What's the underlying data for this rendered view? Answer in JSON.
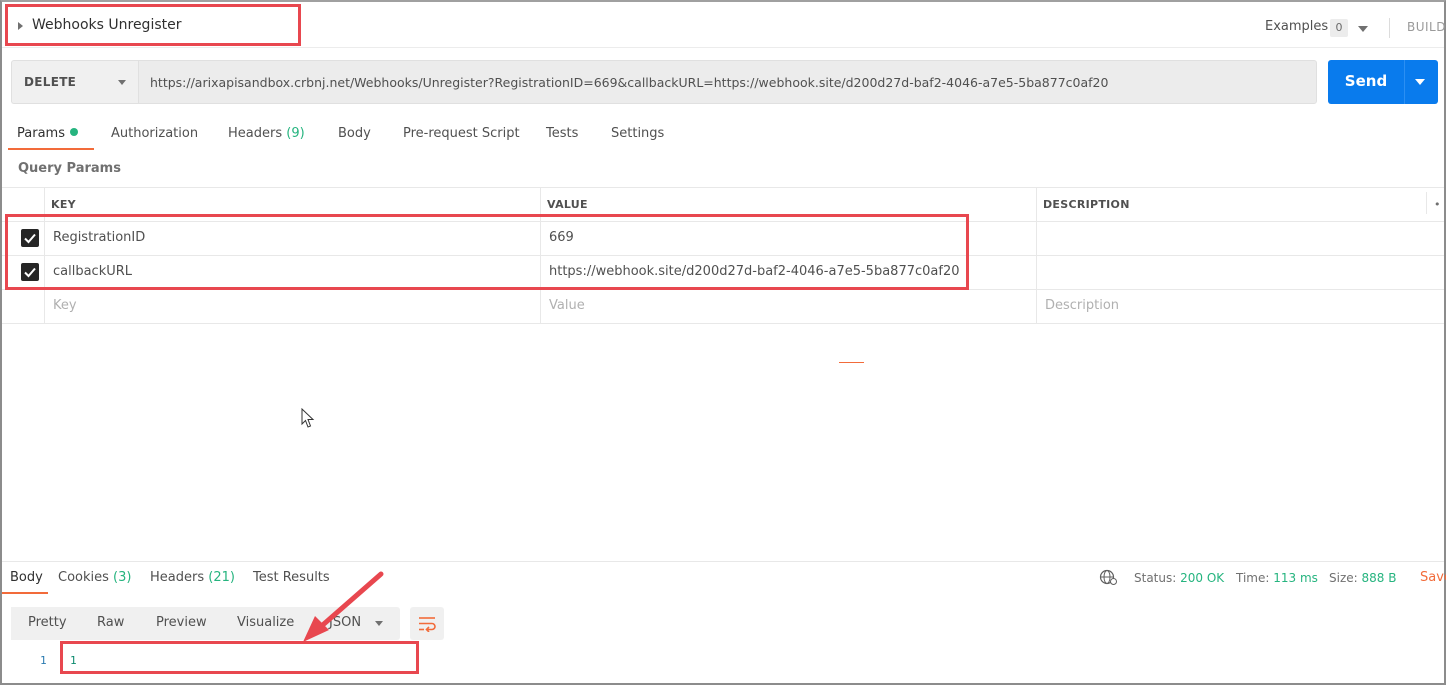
{
  "request": {
    "title": "Webhooks Unregister",
    "examples_label": "Examples",
    "examples_count": "0",
    "build_label": "BUILD"
  },
  "url_bar": {
    "method": "DELETE",
    "url": "https://arixapisandbox.crbnj.net/Webhooks/Unregister?RegistrationID=669&callbackURL=https://webhook.site/d200d27d-baf2-4046-a7e5-5ba877c0af20",
    "send_label": "Send"
  },
  "request_tabs": [
    {
      "label": "Params",
      "active": true,
      "indicator": "green-dot"
    },
    {
      "label": "Authorization"
    },
    {
      "label": "Headers",
      "count": "(9)"
    },
    {
      "label": "Body"
    },
    {
      "label": "Pre-request Script"
    },
    {
      "label": "Tests"
    },
    {
      "label": "Settings"
    }
  ],
  "query_params": {
    "title": "Query Params",
    "columns": [
      "KEY",
      "VALUE",
      "DESCRIPTION"
    ],
    "rows": [
      {
        "checked": true,
        "key": "RegistrationID",
        "value": "669",
        "description": ""
      },
      {
        "checked": true,
        "key": "callbackURL",
        "value": "https://webhook.site/d200d27d-baf2-4046-a7e5-5ba877c0af20",
        "description": ""
      }
    ],
    "placeholders": {
      "key": "Key",
      "value": "Value",
      "description": "Description"
    }
  },
  "response": {
    "tabs": [
      {
        "label": "Body",
        "active": true
      },
      {
        "label": "Cookies",
        "count": "(3)"
      },
      {
        "label": "Headers",
        "count": "(21)"
      },
      {
        "label": "Test Results"
      }
    ],
    "status_label": "Status:",
    "status_value": "200 OK",
    "time_label": "Time:",
    "time_value": "113 ms",
    "size_label": "Size:",
    "size_value": "888 B",
    "save_label": "Save",
    "formats": [
      "Pretty",
      "Raw",
      "Preview",
      "Visualize"
    ],
    "format_selected": "JSON",
    "body_lines": [
      {
        "no": "1",
        "text": "1"
      }
    ]
  },
  "colors": {
    "accent": "#f26b3a",
    "send": "#097bed",
    "success": "#26b47f",
    "highlight": "#e8474f"
  }
}
